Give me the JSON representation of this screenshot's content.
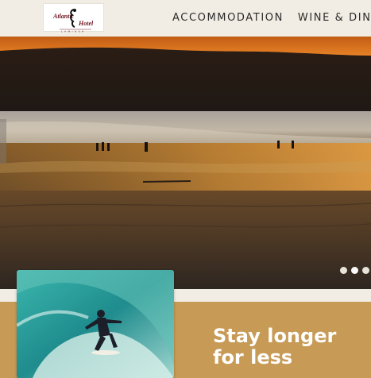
{
  "header": {
    "logo": {
      "lines": [
        "Atlantic",
        "Hotel",
        "LAMINSH"
      ],
      "icon": "seahorse-logo"
    },
    "nav": [
      {
        "label": "ACCOMMODATION"
      },
      {
        "label": "WINE & DINE"
      }
    ]
  },
  "hero": {
    "image": "sunset-beach-with-surfers",
    "carousel": {
      "slides": 3,
      "active": 2
    }
  },
  "promo": {
    "image": "surfer-riding-wave",
    "title_line1": "Stay longer",
    "title_line2": "for less"
  },
  "colors": {
    "background": "#f1ede4",
    "section": "#c79a55",
    "sunset": "#e67a1e",
    "wave": "#2fa4a0"
  }
}
